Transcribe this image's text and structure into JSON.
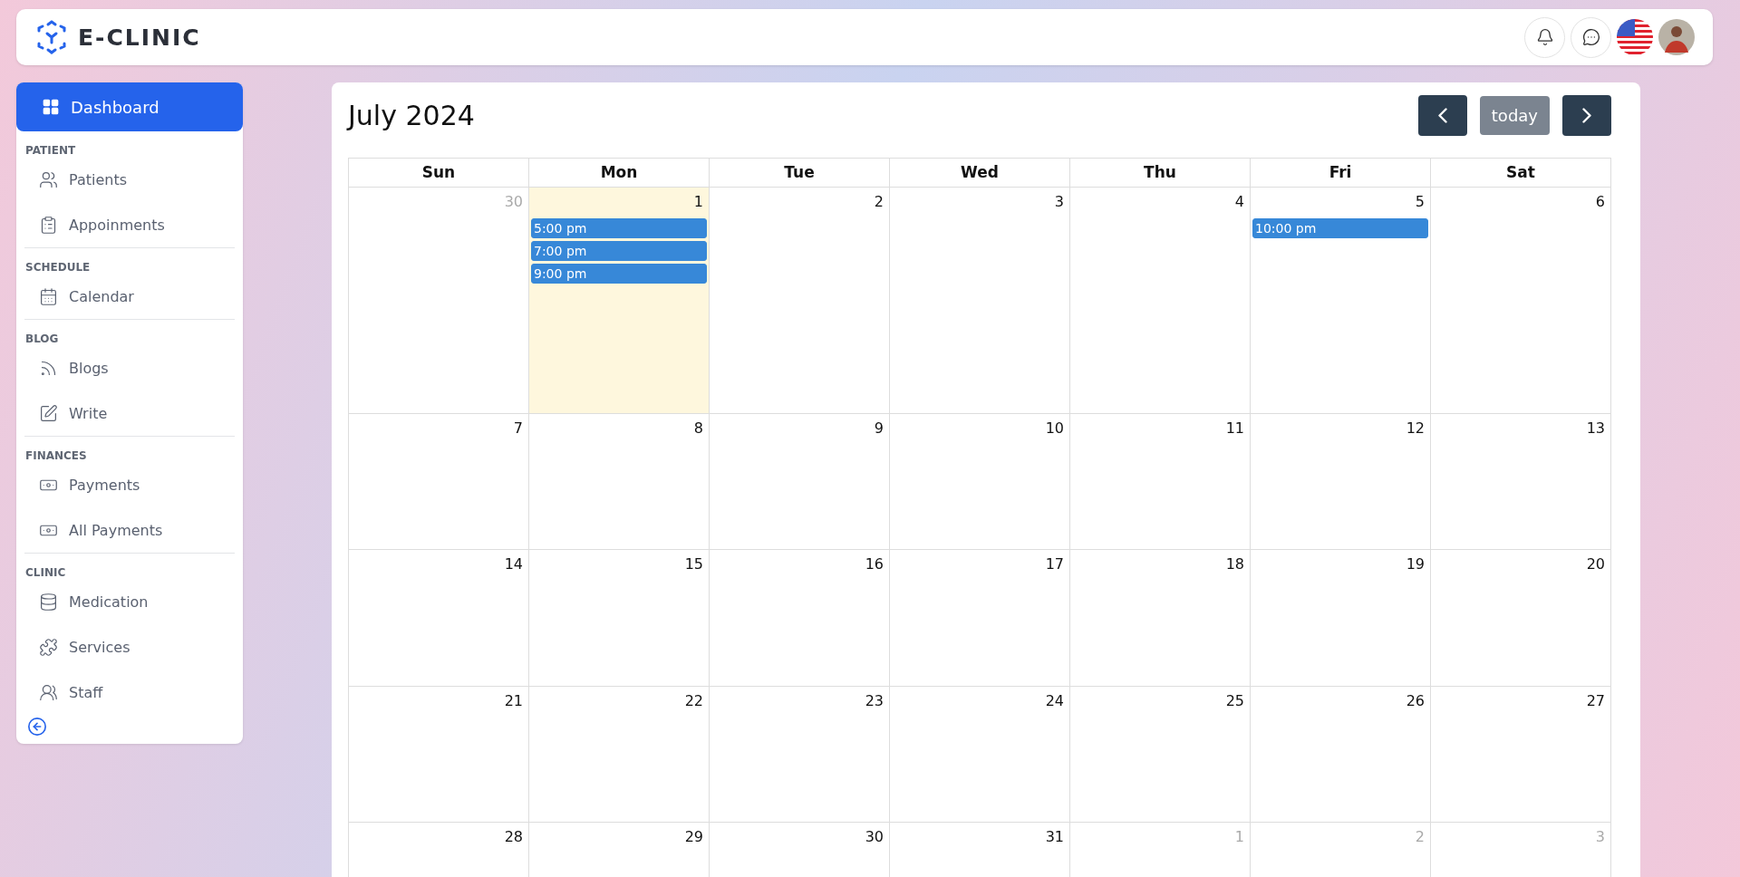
{
  "brand": "E-CLINIC",
  "sidebar": {
    "dashboard": {
      "label": "Dashboard",
      "selected": true
    },
    "sections": [
      {
        "title": "PATIENT",
        "items": [
          {
            "label": "Patients",
            "kind": "people",
            "selected": false
          },
          {
            "label": "Appoinments",
            "kind": "clipboard",
            "selected": false
          }
        ]
      },
      {
        "title": "SCHEDULE",
        "items": [
          {
            "label": "Calendar",
            "kind": "calendar",
            "selected": false
          }
        ]
      },
      {
        "title": "BLOG",
        "items": [
          {
            "label": "Blogs",
            "kind": "rss",
            "selected": false
          },
          {
            "label": "Write",
            "kind": "pencil",
            "selected": false
          }
        ]
      },
      {
        "title": "FINANCES",
        "items": [
          {
            "label": "Payments",
            "kind": "money",
            "selected": false
          },
          {
            "label": "All Payments",
            "kind": "money",
            "selected": false
          }
        ]
      },
      {
        "title": "CLINIC",
        "items": [
          {
            "label": "Medication",
            "kind": "database",
            "selected": false
          },
          {
            "label": "Services",
            "kind": "puzzle",
            "selected": false
          },
          {
            "label": "Staff",
            "kind": "users",
            "selected": false
          }
        ]
      }
    ]
  },
  "calendar": {
    "title": "July 2024",
    "today_button": {
      "label": "today",
      "disabled": true
    },
    "weekdays": [
      "Sun",
      "Mon",
      "Tue",
      "Wed",
      "Thu",
      "Fri",
      "Sat"
    ],
    "weeks": [
      [
        {
          "day": "30",
          "muted": true,
          "today": false
        },
        {
          "day": "1",
          "muted": false,
          "today": true,
          "events": [
            "5:00 pm",
            "7:00 pm",
            "9:00 pm"
          ]
        },
        {
          "day": "2",
          "muted": false,
          "today": false
        },
        {
          "day": "3",
          "muted": false,
          "today": false
        },
        {
          "day": "4",
          "muted": false,
          "today": false
        },
        {
          "day": "5",
          "muted": false,
          "today": false,
          "events": [
            "10:00 pm"
          ]
        },
        {
          "day": "6",
          "muted": false,
          "today": false
        }
      ],
      [
        {
          "day": "7",
          "muted": false,
          "today": false
        },
        {
          "day": "8",
          "muted": false,
          "today": false
        },
        {
          "day": "9",
          "muted": false,
          "today": false
        },
        {
          "day": "10",
          "muted": false,
          "today": false
        },
        {
          "day": "11",
          "muted": false,
          "today": false
        },
        {
          "day": "12",
          "muted": false,
          "today": false
        },
        {
          "day": "13",
          "muted": false,
          "today": false
        }
      ],
      [
        {
          "day": "14",
          "muted": false,
          "today": false
        },
        {
          "day": "15",
          "muted": false,
          "today": false
        },
        {
          "day": "16",
          "muted": false,
          "today": false
        },
        {
          "day": "17",
          "muted": false,
          "today": false
        },
        {
          "day": "18",
          "muted": false,
          "today": false
        },
        {
          "day": "19",
          "muted": false,
          "today": false
        },
        {
          "day": "20",
          "muted": false,
          "today": false
        }
      ],
      [
        {
          "day": "21",
          "muted": false,
          "today": false
        },
        {
          "day": "22",
          "muted": false,
          "today": false
        },
        {
          "day": "23",
          "muted": false,
          "today": false
        },
        {
          "day": "24",
          "muted": false,
          "today": false
        },
        {
          "day": "25",
          "muted": false,
          "today": false
        },
        {
          "day": "26",
          "muted": false,
          "today": false
        },
        {
          "day": "27",
          "muted": false,
          "today": false
        }
      ],
      [
        {
          "day": "28",
          "muted": false,
          "today": false
        },
        {
          "day": "29",
          "muted": false,
          "today": false
        },
        {
          "day": "30",
          "muted": false,
          "today": false
        },
        {
          "day": "31",
          "muted": false,
          "today": false
        },
        {
          "day": "1",
          "muted": true,
          "today": false
        },
        {
          "day": "2",
          "muted": true,
          "today": false
        },
        {
          "day": "3",
          "muted": true,
          "today": false
        }
      ]
    ]
  }
}
